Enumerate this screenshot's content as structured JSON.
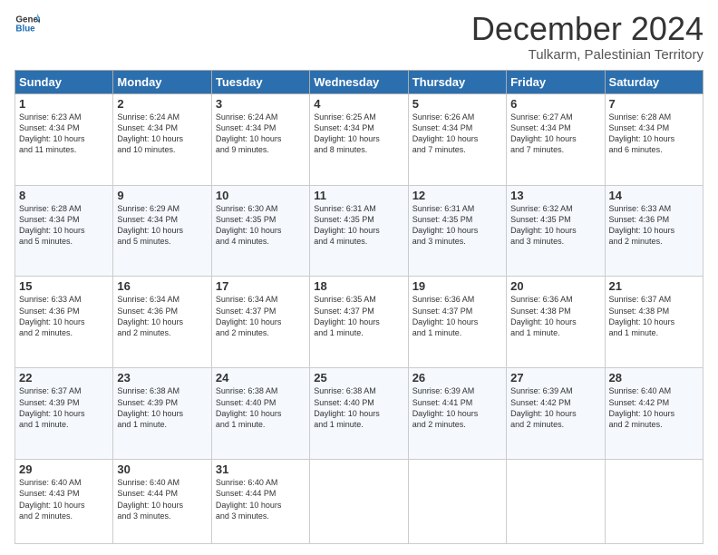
{
  "header": {
    "logo_line1": "General",
    "logo_line2": "Blue",
    "month": "December 2024",
    "location": "Tulkarm, Palestinian Territory"
  },
  "days_of_week": [
    "Sunday",
    "Monday",
    "Tuesday",
    "Wednesday",
    "Thursday",
    "Friday",
    "Saturday"
  ],
  "weeks": [
    [
      {
        "day": "1",
        "lines": [
          "Sunrise: 6:23 AM",
          "Sunset: 4:34 PM",
          "Daylight: 10 hours",
          "and 11 minutes."
        ]
      },
      {
        "day": "2",
        "lines": [
          "Sunrise: 6:24 AM",
          "Sunset: 4:34 PM",
          "Daylight: 10 hours",
          "and 10 minutes."
        ]
      },
      {
        "day": "3",
        "lines": [
          "Sunrise: 6:24 AM",
          "Sunset: 4:34 PM",
          "Daylight: 10 hours",
          "and 9 minutes."
        ]
      },
      {
        "day": "4",
        "lines": [
          "Sunrise: 6:25 AM",
          "Sunset: 4:34 PM",
          "Daylight: 10 hours",
          "and 8 minutes."
        ]
      },
      {
        "day": "5",
        "lines": [
          "Sunrise: 6:26 AM",
          "Sunset: 4:34 PM",
          "Daylight: 10 hours",
          "and 7 minutes."
        ]
      },
      {
        "day": "6",
        "lines": [
          "Sunrise: 6:27 AM",
          "Sunset: 4:34 PM",
          "Daylight: 10 hours",
          "and 7 minutes."
        ]
      },
      {
        "day": "7",
        "lines": [
          "Sunrise: 6:28 AM",
          "Sunset: 4:34 PM",
          "Daylight: 10 hours",
          "and 6 minutes."
        ]
      }
    ],
    [
      {
        "day": "8",
        "lines": [
          "Sunrise: 6:28 AM",
          "Sunset: 4:34 PM",
          "Daylight: 10 hours",
          "and 5 minutes."
        ]
      },
      {
        "day": "9",
        "lines": [
          "Sunrise: 6:29 AM",
          "Sunset: 4:34 PM",
          "Daylight: 10 hours",
          "and 5 minutes."
        ]
      },
      {
        "day": "10",
        "lines": [
          "Sunrise: 6:30 AM",
          "Sunset: 4:35 PM",
          "Daylight: 10 hours",
          "and 4 minutes."
        ]
      },
      {
        "day": "11",
        "lines": [
          "Sunrise: 6:31 AM",
          "Sunset: 4:35 PM",
          "Daylight: 10 hours",
          "and 4 minutes."
        ]
      },
      {
        "day": "12",
        "lines": [
          "Sunrise: 6:31 AM",
          "Sunset: 4:35 PM",
          "Daylight: 10 hours",
          "and 3 minutes."
        ]
      },
      {
        "day": "13",
        "lines": [
          "Sunrise: 6:32 AM",
          "Sunset: 4:35 PM",
          "Daylight: 10 hours",
          "and 3 minutes."
        ]
      },
      {
        "day": "14",
        "lines": [
          "Sunrise: 6:33 AM",
          "Sunset: 4:36 PM",
          "Daylight: 10 hours",
          "and 2 minutes."
        ]
      }
    ],
    [
      {
        "day": "15",
        "lines": [
          "Sunrise: 6:33 AM",
          "Sunset: 4:36 PM",
          "Daylight: 10 hours",
          "and 2 minutes."
        ]
      },
      {
        "day": "16",
        "lines": [
          "Sunrise: 6:34 AM",
          "Sunset: 4:36 PM",
          "Daylight: 10 hours",
          "and 2 minutes."
        ]
      },
      {
        "day": "17",
        "lines": [
          "Sunrise: 6:34 AM",
          "Sunset: 4:37 PM",
          "Daylight: 10 hours",
          "and 2 minutes."
        ]
      },
      {
        "day": "18",
        "lines": [
          "Sunrise: 6:35 AM",
          "Sunset: 4:37 PM",
          "Daylight: 10 hours",
          "and 1 minute."
        ]
      },
      {
        "day": "19",
        "lines": [
          "Sunrise: 6:36 AM",
          "Sunset: 4:37 PM",
          "Daylight: 10 hours",
          "and 1 minute."
        ]
      },
      {
        "day": "20",
        "lines": [
          "Sunrise: 6:36 AM",
          "Sunset: 4:38 PM",
          "Daylight: 10 hours",
          "and 1 minute."
        ]
      },
      {
        "day": "21",
        "lines": [
          "Sunrise: 6:37 AM",
          "Sunset: 4:38 PM",
          "Daylight: 10 hours",
          "and 1 minute."
        ]
      }
    ],
    [
      {
        "day": "22",
        "lines": [
          "Sunrise: 6:37 AM",
          "Sunset: 4:39 PM",
          "Daylight: 10 hours",
          "and 1 minute."
        ]
      },
      {
        "day": "23",
        "lines": [
          "Sunrise: 6:38 AM",
          "Sunset: 4:39 PM",
          "Daylight: 10 hours",
          "and 1 minute."
        ]
      },
      {
        "day": "24",
        "lines": [
          "Sunrise: 6:38 AM",
          "Sunset: 4:40 PM",
          "Daylight: 10 hours",
          "and 1 minute."
        ]
      },
      {
        "day": "25",
        "lines": [
          "Sunrise: 6:38 AM",
          "Sunset: 4:40 PM",
          "Daylight: 10 hours",
          "and 1 minute."
        ]
      },
      {
        "day": "26",
        "lines": [
          "Sunrise: 6:39 AM",
          "Sunset: 4:41 PM",
          "Daylight: 10 hours",
          "and 2 minutes."
        ]
      },
      {
        "day": "27",
        "lines": [
          "Sunrise: 6:39 AM",
          "Sunset: 4:42 PM",
          "Daylight: 10 hours",
          "and 2 minutes."
        ]
      },
      {
        "day": "28",
        "lines": [
          "Sunrise: 6:40 AM",
          "Sunset: 4:42 PM",
          "Daylight: 10 hours",
          "and 2 minutes."
        ]
      }
    ],
    [
      {
        "day": "29",
        "lines": [
          "Sunrise: 6:40 AM",
          "Sunset: 4:43 PM",
          "Daylight: 10 hours",
          "and 2 minutes."
        ]
      },
      {
        "day": "30",
        "lines": [
          "Sunrise: 6:40 AM",
          "Sunset: 4:44 PM",
          "Daylight: 10 hours",
          "and 3 minutes."
        ]
      },
      {
        "day": "31",
        "lines": [
          "Sunrise: 6:40 AM",
          "Sunset: 4:44 PM",
          "Daylight: 10 hours",
          "and 3 minutes."
        ]
      },
      null,
      null,
      null,
      null
    ]
  ]
}
